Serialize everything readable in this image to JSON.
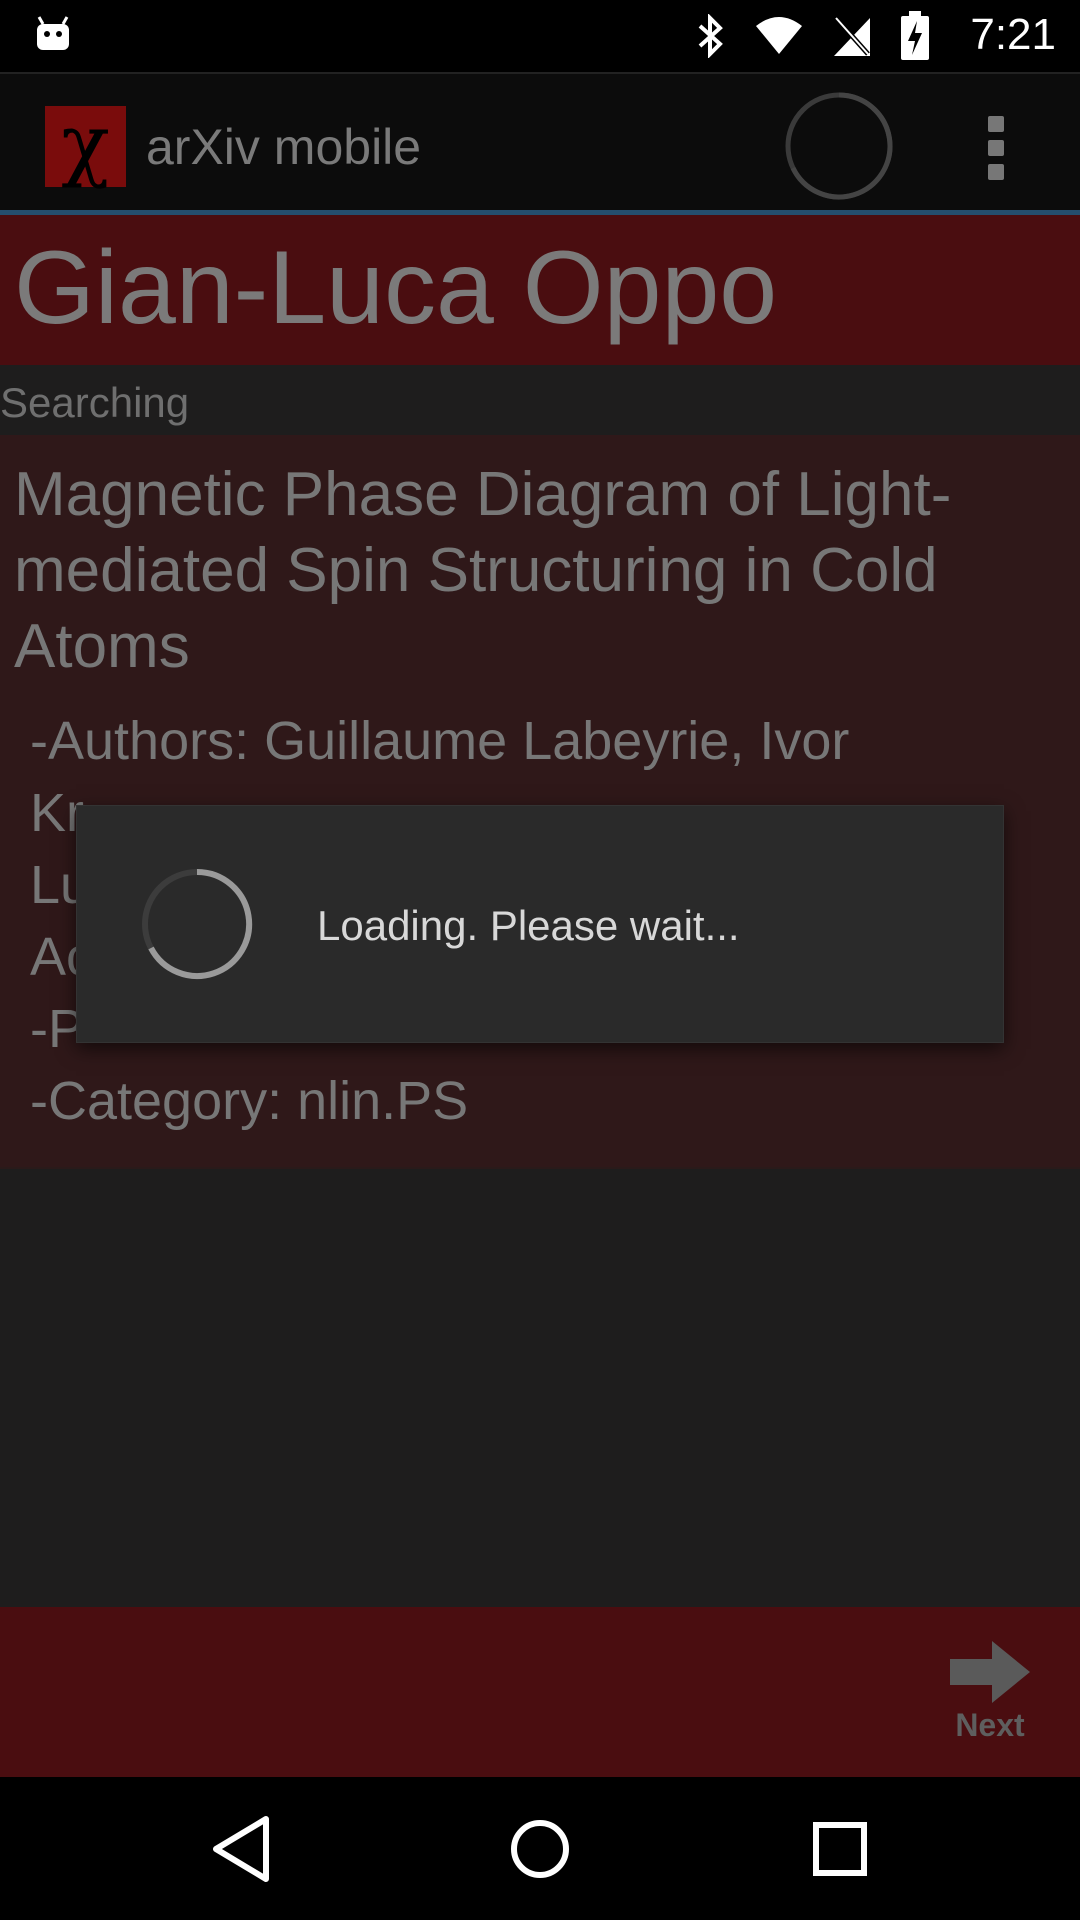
{
  "status_bar": {
    "time": "7:21",
    "icons": [
      "android-robot-icon",
      "bluetooth-icon",
      "wifi-icon",
      "no-signal-icon",
      "battery-charging-icon"
    ]
  },
  "action_bar": {
    "app_title": "arXiv mobile",
    "logo_glyph": "χ",
    "logo_color": "#7a0c0c"
  },
  "author": {
    "name": "Gian-Luca Oppo"
  },
  "status": {
    "text": "Searching"
  },
  "paper": {
    "title": "Magnetic Phase Diagram of Light-mediated Spin Structuring in Cold Atoms",
    "authors_line": "-Authors: Guillaume Labeyrie, Ivor",
    "authors_cont_1": "Kr",
    "authors_cont_2": "Lu",
    "authors_cont_3": "Ac",
    "published": "-P",
    "category": "-Category: nlin.PS"
  },
  "bottom_bar": {
    "next_label": "Next"
  },
  "dialog": {
    "message": "Loading. Please wait..."
  },
  "colors": {
    "header_bg": "#4a0d10",
    "card_bg": "#2f1819",
    "accent_line": "#244e6e"
  }
}
